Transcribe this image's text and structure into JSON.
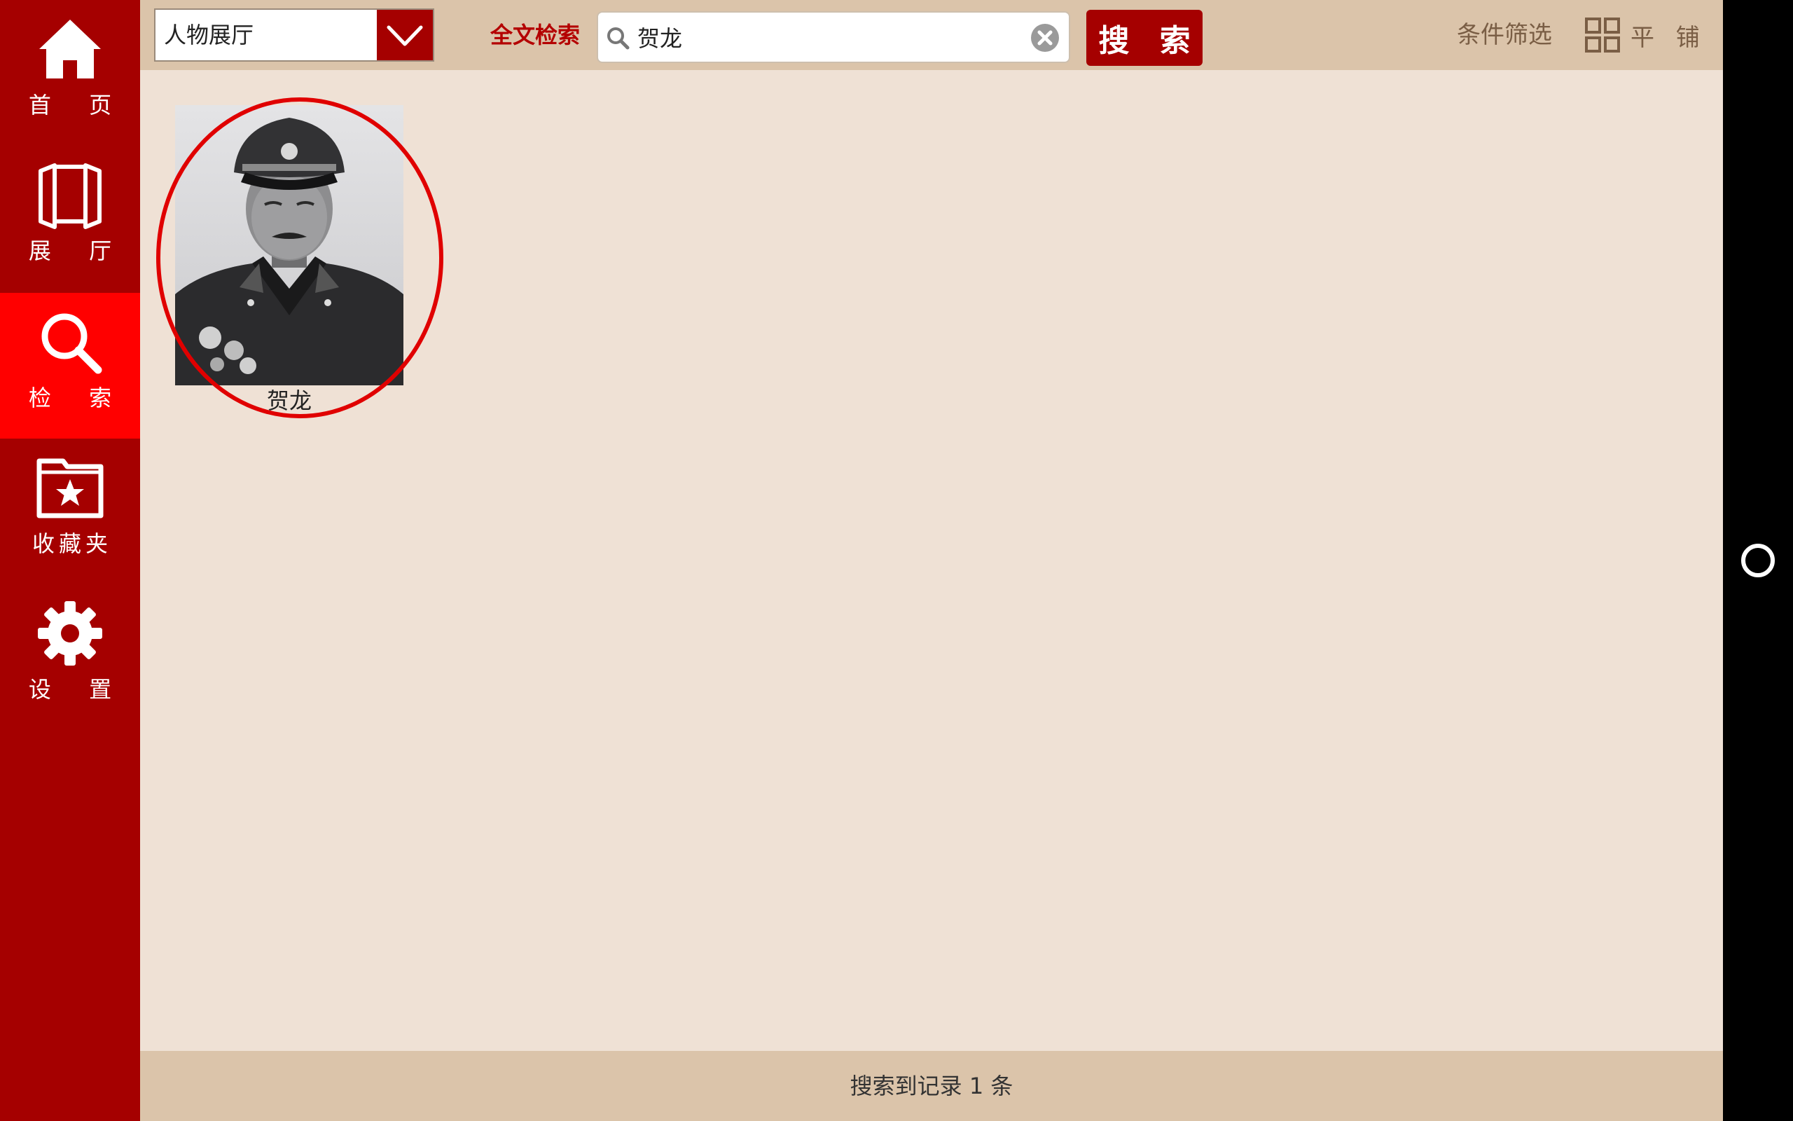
{
  "sidebar": {
    "items": [
      {
        "label": "首 页",
        "icon": "home-icon"
      },
      {
        "label": "展 厅",
        "icon": "hall-icon"
      },
      {
        "label": "检 索",
        "icon": "search-icon",
        "active": true
      },
      {
        "label": "收藏夹",
        "icon": "favorites-folder-icon"
      },
      {
        "label": "设 置",
        "icon": "gear-icon"
      }
    ]
  },
  "toolbar": {
    "hall_select_value": "人物展厅",
    "fulltext_label": "全文检索",
    "search_value": "贺龙",
    "search_button": "搜 索",
    "filter_label": "条件筛选",
    "tile_label": "平 铺"
  },
  "results": [
    {
      "name": "贺龙"
    }
  ],
  "status": {
    "text": "搜索到记录 1 条"
  },
  "colors": {
    "sidebar": "#a50000",
    "sidebar_active": "#ff0000",
    "toolbar": "#dbc4aa",
    "content": "#efe1d5",
    "accent_text": "#b40000",
    "highlight_ring": "#e00000"
  }
}
